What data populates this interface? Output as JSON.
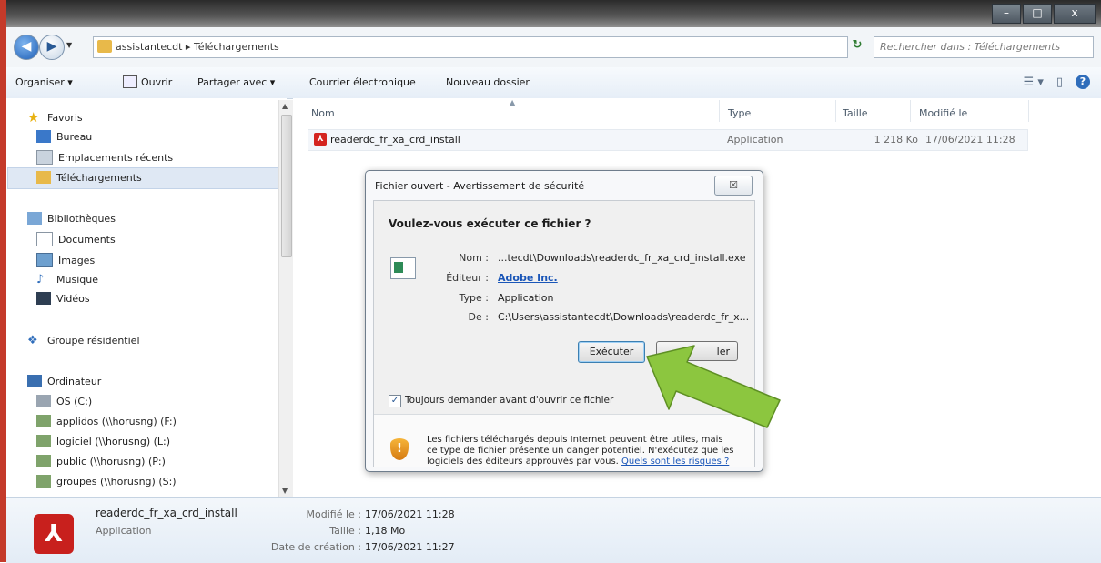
{
  "window": {
    "minimize": "–",
    "maximize": "□",
    "close": "x"
  },
  "address": {
    "path": "assistantecdt  ▸  Téléchargements",
    "search_placeholder": "Rechercher dans : Téléchargements"
  },
  "toolbar": {
    "organize": "Organiser ▾",
    "open": "Ouvrir",
    "share": "Partager avec ▾",
    "email": "Courrier électronique",
    "new_folder": "Nouveau dossier"
  },
  "nav": {
    "favorites": "Favoris",
    "bureau": "Bureau",
    "recent": "Emplacements récents",
    "downloads": "Téléchargements",
    "libraries": "Bibliothèques",
    "documents": "Documents",
    "images": "Images",
    "music": "Musique",
    "videos": "Vidéos",
    "homegroup": "Groupe résidentiel",
    "computer": "Ordinateur",
    "drive_c": "OS (C:)",
    "drive_f": "applidos (\\\\horusng) (F:)",
    "drive_l": "logiciel (\\\\horusng) (L:)",
    "drive_p": "public (\\\\horusng) (P:)",
    "drive_s": "groupes (\\\\horusng) (S:)"
  },
  "columns": {
    "name": "Nom",
    "type": "Type",
    "size": "Taille",
    "modified": "Modifié le"
  },
  "file": {
    "name": "readerdc_fr_xa_crd_install",
    "type": "Application",
    "size": "1 218 Ko",
    "modified": "17/06/2021 11:28"
  },
  "dialog": {
    "title": "Fichier ouvert - Avertissement de sécurité",
    "close": "☒",
    "question": "Voulez-vous exécuter ce fichier ?",
    "name_label": "Nom :",
    "name_value": "...tecdt\\Downloads\\readerdc_fr_xa_crd_install.exe",
    "publisher_label": "Éditeur :",
    "publisher_value": "Adobe Inc.",
    "type_label": "Type :",
    "type_value": "Application",
    "from_label": "De :",
    "from_value": "C:\\Users\\assistantecdt\\Downloads\\readerdc_fr_x...",
    "run": "Exécuter",
    "cancel_visible": "ler",
    "checkbox_label": "Toujours demander avant d'ouvrir ce fichier",
    "warning_text": "Les fichiers téléchargés depuis Internet peuvent être utiles, mais ce type de fichier présente un danger potentiel. N'exécutez que les logiciels des éditeurs approuvés par vous.",
    "risk_link": "Quels sont les risques ?"
  },
  "details": {
    "name": "readerdc_fr_xa_crd_install",
    "type": "Application",
    "modified_label": "Modifié le :",
    "modified_value": "17/06/2021 11:28",
    "size_label": "Taille :",
    "size_value": "1,18 Mo",
    "created_label": "Date de création :",
    "created_value": "17/06/2021 11:27"
  },
  "colors": {
    "accent": "#1a56b8",
    "arrow": "#8cc63f",
    "pdf": "#c8201d"
  }
}
